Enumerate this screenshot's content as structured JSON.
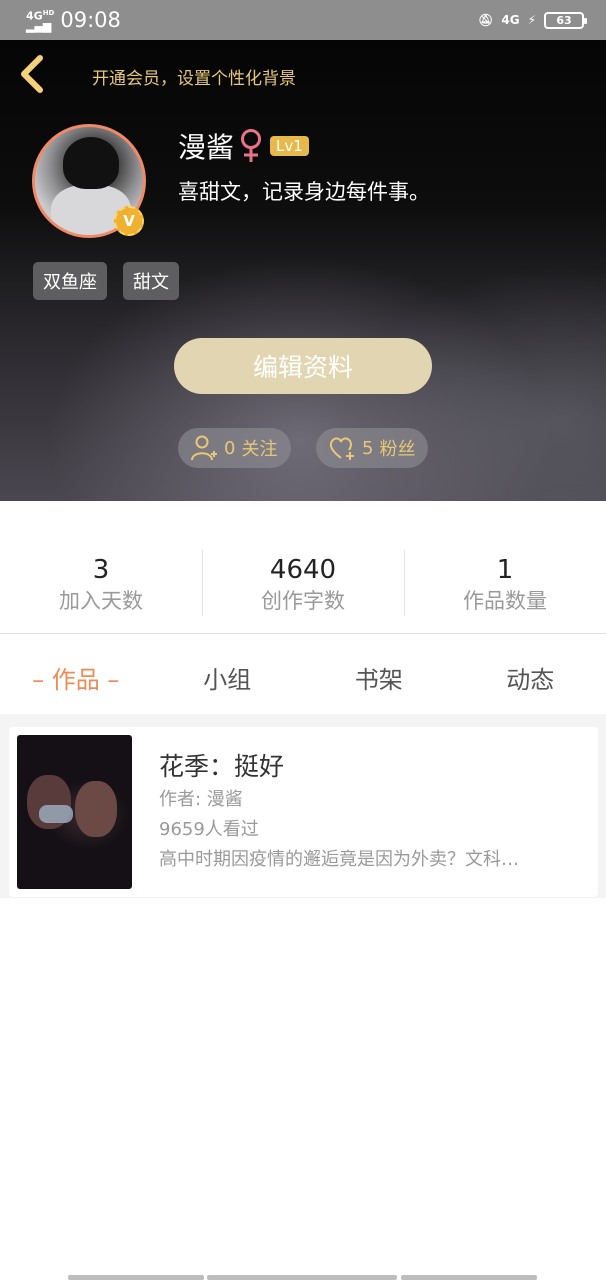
{
  "status_bar": {
    "network": "4G",
    "network_hd": "HD",
    "time": "09:08",
    "network_right": "4G",
    "battery": "63"
  },
  "header": {
    "vip_tip": "开通会员，设置个性化背景",
    "badge_v": "V",
    "name": "漫酱",
    "gender_symbol": "♀",
    "level": "Lv1",
    "bio": "喜甜文，记录身边每件事。",
    "tags": [
      "双鱼座",
      "甜文"
    ],
    "edit_button": "编辑资料",
    "follow": {
      "count": "0",
      "label": "关注"
    },
    "fans": {
      "count": "5",
      "label": "粉丝"
    }
  },
  "stats": [
    {
      "value": "3",
      "label": "加入天数"
    },
    {
      "value": "4640",
      "label": "创作字数"
    },
    {
      "value": "1",
      "label": "作品数量"
    }
  ],
  "tabs": [
    "– 作品 –",
    "小组",
    "书架",
    "动态"
  ],
  "works": [
    {
      "title": "花季：挺好",
      "author": "作者: 漫酱",
      "views": "9659人看过",
      "description": "高中时期因疫情的邂逅竟是因为外卖？文科…"
    }
  ],
  "colors": {
    "accent": "#f08a56",
    "gold": "#e8c878",
    "edit_button": "#e2d6b2"
  }
}
